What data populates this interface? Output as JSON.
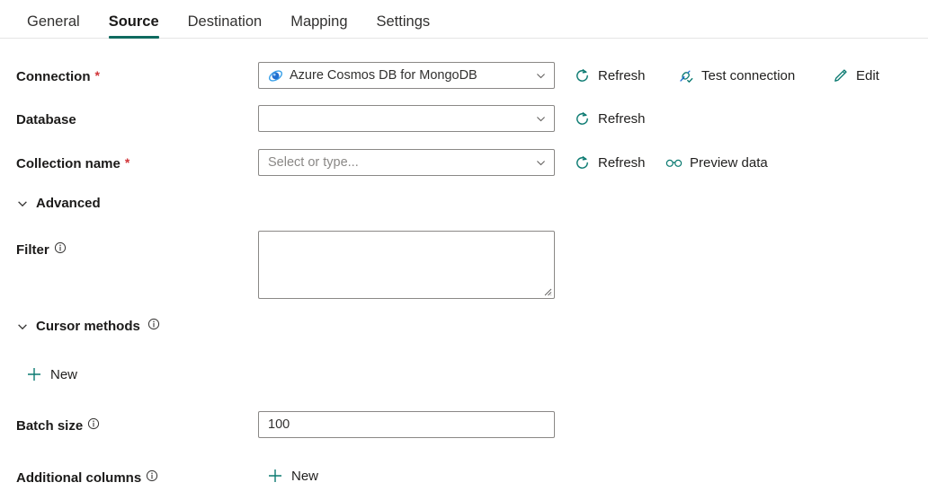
{
  "tabs": [
    {
      "label": "General",
      "active": false
    },
    {
      "label": "Source",
      "active": true
    },
    {
      "label": "Destination",
      "active": false
    },
    {
      "label": "Mapping",
      "active": false
    },
    {
      "label": "Settings",
      "active": false
    }
  ],
  "colors": {
    "accent_teal": "#0f6a5f",
    "icon_teal": "#0b7a71",
    "required_red": "#d13438",
    "border": "#8a8886",
    "placeholder": "#8a8886",
    "text": "#201f1e"
  },
  "fields": {
    "connection": {
      "label": "Connection",
      "required": "*",
      "value": "Azure Cosmos DB for MongoDB",
      "icon": "azure-cosmos-db-icon",
      "actions": [
        {
          "label": "Refresh",
          "icon": "refresh-icon"
        },
        {
          "label": "Test connection",
          "icon": "plug-check-icon"
        },
        {
          "label": "Edit",
          "icon": "pencil-icon"
        }
      ]
    },
    "database": {
      "label": "Database",
      "required": "",
      "value": "",
      "placeholder": "",
      "actions": [
        {
          "label": "Refresh",
          "icon": "refresh-icon"
        }
      ]
    },
    "collection_name": {
      "label": "Collection name",
      "required": "*",
      "value": "",
      "placeholder": "Select or type...",
      "actions": [
        {
          "label": "Refresh",
          "icon": "refresh-icon"
        },
        {
          "label": "Preview data",
          "icon": "glasses-icon"
        }
      ]
    },
    "advanced_section": {
      "label": "Advanced",
      "expanded": true,
      "chevron": "chevron-down-icon"
    },
    "filter": {
      "label": "Filter",
      "info": "info-icon",
      "value": ""
    },
    "cursor_methods_section": {
      "label": "Cursor methods",
      "info": "info-icon",
      "expanded": true,
      "chevron": "chevron-down-icon",
      "new_label": "New",
      "new_icon": "plus-icon"
    },
    "batch_size": {
      "label": "Batch size",
      "info": "info-icon",
      "value": "100"
    },
    "additional_columns": {
      "label": "Additional columns",
      "info": "info-icon",
      "new_label": "New",
      "new_icon": "plus-icon"
    }
  }
}
